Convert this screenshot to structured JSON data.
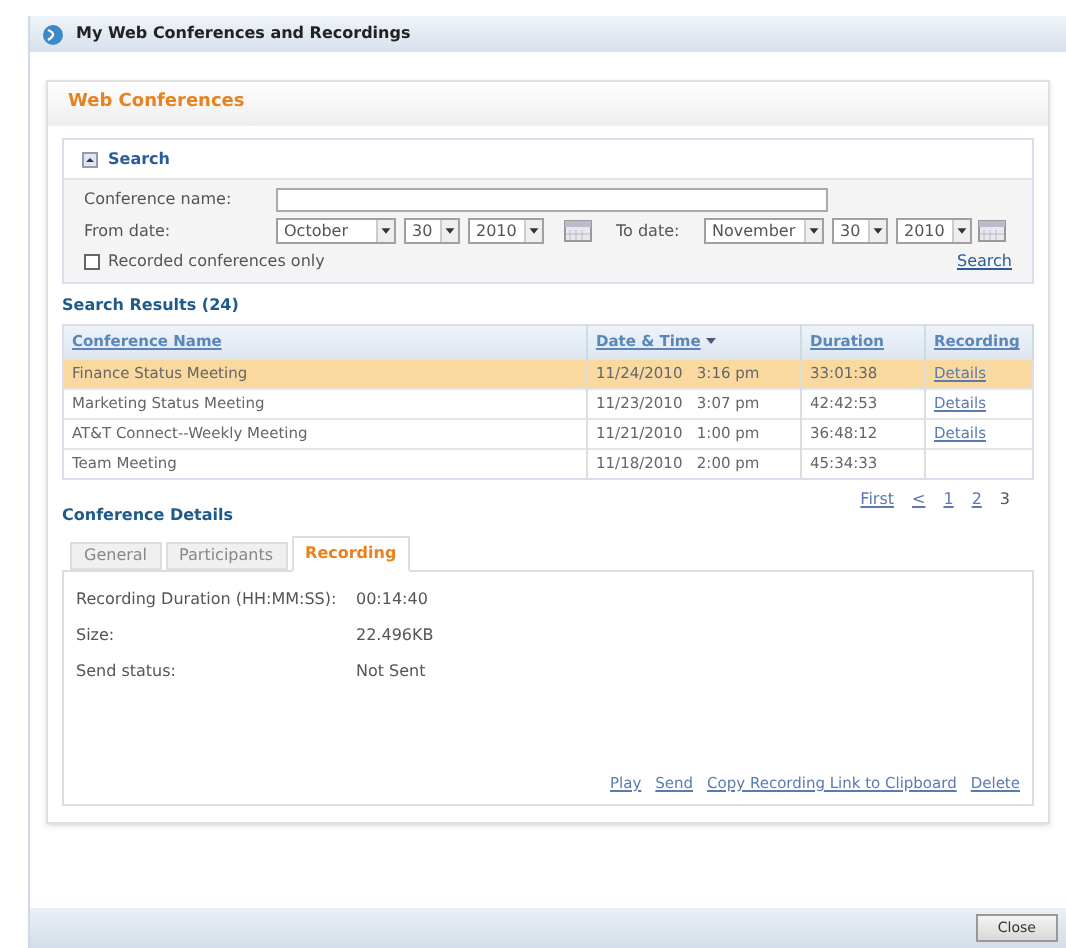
{
  "window": {
    "title": "My Web Conferences and Recordings"
  },
  "section": {
    "title": "Web Conferences"
  },
  "search": {
    "title": "Search",
    "expanded": true,
    "name_label": "Conference name:",
    "from_label": "From date:",
    "from": {
      "month": "October",
      "day": "30",
      "year": "2010"
    },
    "to_label": "To date:",
    "to": {
      "month": "November",
      "day": "30",
      "year": "2010"
    },
    "recorded_only": {
      "label": "Recorded conferences only",
      "checked": false
    },
    "search_link": "Search"
  },
  "results": {
    "title": "Search Results (24)",
    "columns": [
      {
        "label": "Conference Name",
        "sorted": false
      },
      {
        "label": "Date & Time",
        "sorted": true
      },
      {
        "label": "Duration",
        "sorted": false
      },
      {
        "label": "Recording",
        "sorted": false
      }
    ],
    "rows": [
      {
        "name": "Finance Status Meeting",
        "date": "11/24/2010",
        "time": "3:16 pm",
        "duration": "33:01:38",
        "recording": "Details",
        "selected": true
      },
      {
        "name": "Marketing Status Meeting",
        "date": "11/23/2010",
        "time": "3:07 pm",
        "duration": "42:42:53",
        "recording": "Details",
        "selected": false
      },
      {
        "name": "AT&T Connect--Weekly Meeting",
        "date": "11/21/2010",
        "time": "1:00 pm",
        "duration": "36:48:12",
        "recording": "Details",
        "selected": false
      },
      {
        "name": "Team Meeting",
        "date": "11/18/2010",
        "time": "2:00 pm",
        "duration": "45:34:33",
        "selected": false
      }
    ],
    "pagination": [
      {
        "label": "First",
        "selected": false
      },
      {
        "label": "<",
        "selected": false
      },
      {
        "label": "1",
        "selected": false
      },
      {
        "label": "2",
        "selected": false
      },
      {
        "label": "3",
        "selected": true
      }
    ]
  },
  "details": {
    "title": "Conference Details",
    "tabs": [
      {
        "label": "General",
        "selected": false
      },
      {
        "label": "Participants",
        "selected": false
      },
      {
        "label": "Recording",
        "selected": true
      }
    ],
    "fields": [
      {
        "label": "Recording Duration (HH:MM:SS):",
        "value": "00:14:40"
      },
      {
        "label": "Size:",
        "value": "22.496KB"
      },
      {
        "label": "Send status:",
        "value": "Not Sent"
      }
    ],
    "actions": [
      "Play",
      "Send",
      "Copy Recording Link to Clipboard",
      "Delete"
    ]
  },
  "footer": {
    "button": "Close"
  }
}
